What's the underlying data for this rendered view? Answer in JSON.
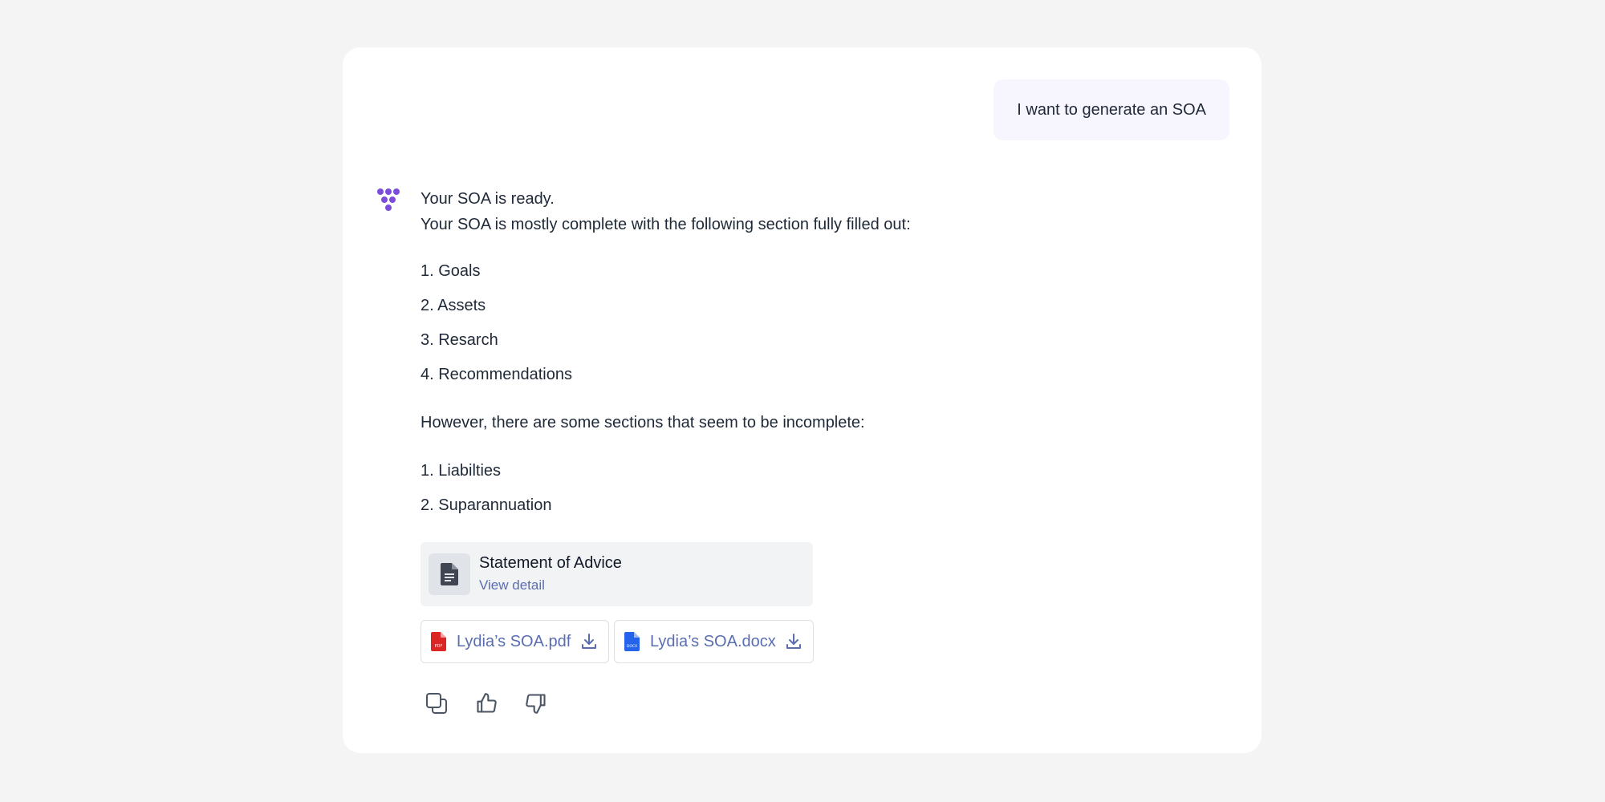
{
  "user_message": {
    "text": "I want to generate an SOA"
  },
  "assistant": {
    "avatar_icon": "grape-cluster-logo-icon",
    "accent_color": "#7c4ddb",
    "line1": "Your SOA is ready.",
    "line2": "Your SOA is mostly complete with the following section fully filled out:",
    "complete_sections": [
      "1. Goals",
      "2. Assets",
      "3. Resarch",
      "4. Recommendations"
    ],
    "incomplete_intro": "However, there are some sections that seem to be incomplete:",
    "incomplete_sections": [
      "1. Liabilties",
      "2. Suparannuation"
    ],
    "document_card": {
      "icon": "document-icon",
      "title": "Statement of Advice",
      "link_label": "View detail"
    },
    "files": [
      {
        "icon": "pdf-file-icon",
        "icon_label": "PDF",
        "color": "#dc2626",
        "name": "Lydia’s SOA.pdf"
      },
      {
        "icon": "docx-file-icon",
        "icon_label": "DOCX",
        "color": "#2563eb",
        "name": "Lydia’s SOA.docx"
      }
    ],
    "actions": [
      "copy-icon",
      "thumbs-up-icon",
      "thumbs-down-icon"
    ]
  }
}
